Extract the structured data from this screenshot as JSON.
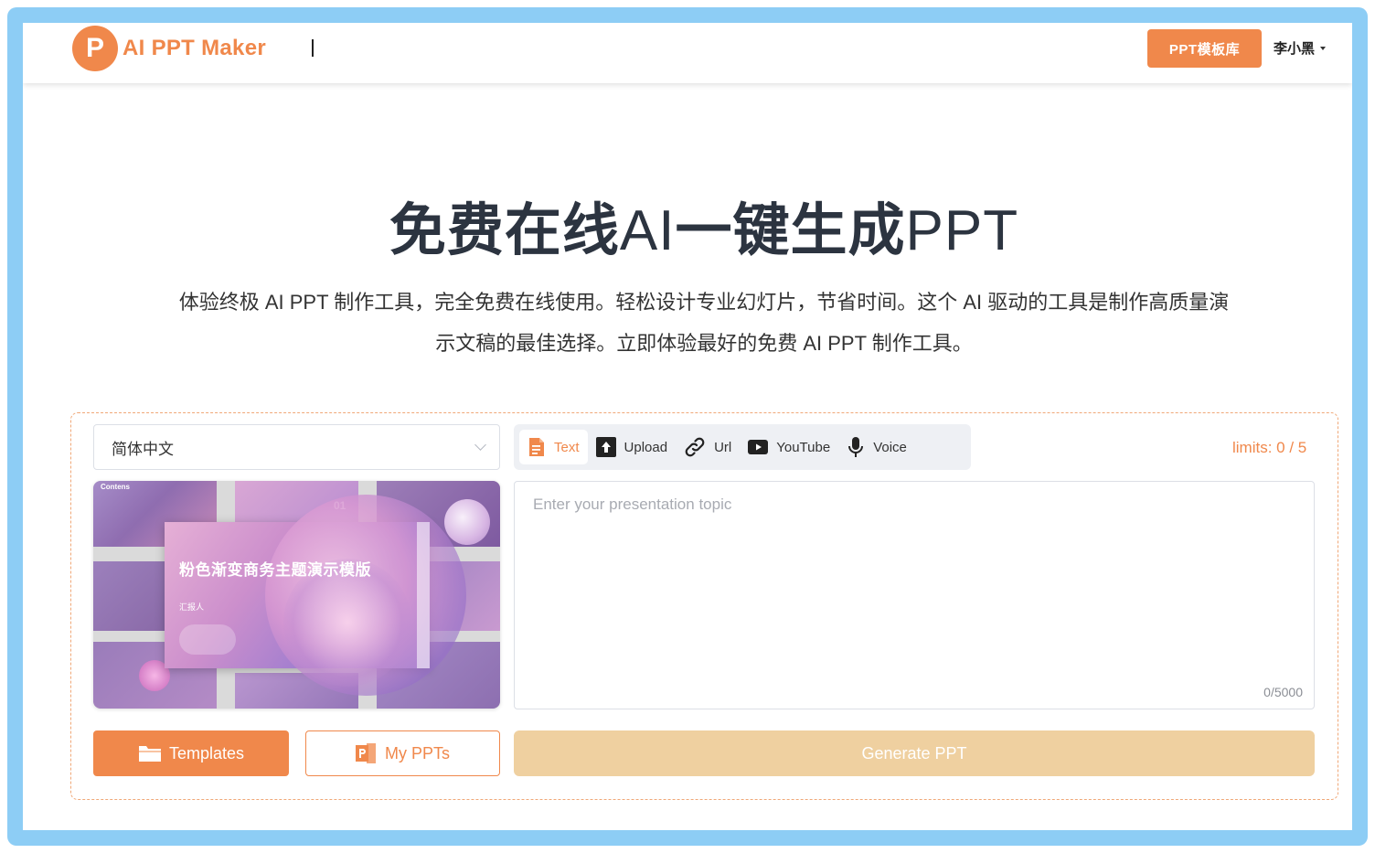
{
  "header": {
    "logo_letter": "P",
    "logo_text": "AI PPT Maker",
    "template_library_button": "PPT模板库",
    "user_name": "李小黑"
  },
  "hero": {
    "title_cn": "免费在线",
    "title_ai": "AI",
    "title_cn2": "一键生成",
    "title_ppt": "PPT",
    "subtitle": "体验终极 AI PPT 制作工具，完全免费在线使用。轻松设计专业幻灯片，节省时间。这个 AI 驱动的工具是制作高质量演示文稿的最佳选择。立即体验最好的免费 AI PPT 制作工具。"
  },
  "form": {
    "language_selected": "简体中文",
    "tabs": [
      {
        "label": "Text",
        "icon": "document-icon",
        "active": true
      },
      {
        "label": "Upload",
        "icon": "upload-icon",
        "active": false
      },
      {
        "label": "Url",
        "icon": "link-icon",
        "active": false
      },
      {
        "label": "YouTube",
        "icon": "youtube-icon",
        "active": false
      },
      {
        "label": "Voice",
        "icon": "microphone-icon",
        "active": false
      }
    ],
    "limits": "limits: 0 / 5",
    "topic_placeholder": "Enter your presentation topic",
    "char_count": "0/5000",
    "templates_button": "Templates",
    "my_ppts_button": "My PPTs",
    "generate_button": "Generate PPT"
  },
  "preview": {
    "slide_title": "粉色渐变商务主题演示模版",
    "slide_reporter": "汇报人",
    "contents_label": "Contens",
    "section_number": "01"
  },
  "colors": {
    "accent": "#f0884b",
    "frame": "#8dcdf5",
    "generate_disabled": "#efd0a0",
    "title_text": "#2c3440"
  }
}
